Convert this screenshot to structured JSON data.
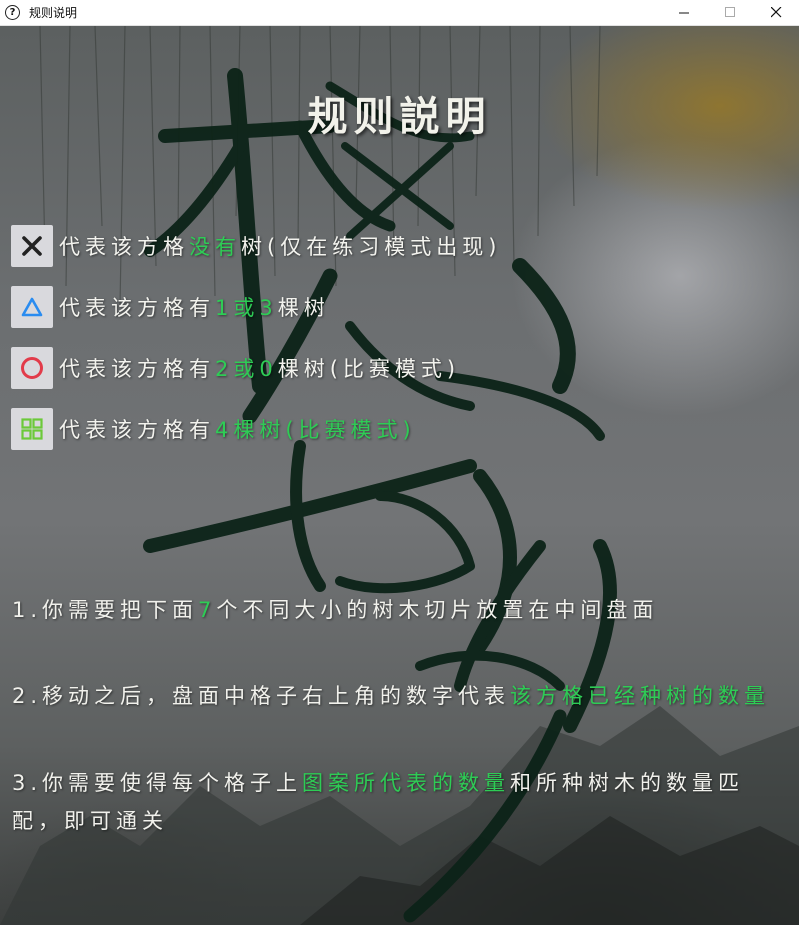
{
  "window": {
    "title": "规则说明",
    "icon": "question-icon",
    "controls": [
      "minimize-icon",
      "maximize-icon",
      "close-icon"
    ]
  },
  "header": {
    "title": "规则説明"
  },
  "watermark": {
    "text": "栖林智缘"
  },
  "legend": [
    {
      "icon": "cross-icon",
      "icon_color": "#222222",
      "parts": [
        {
          "text": "代表该方格",
          "hl": false
        },
        {
          "text": "没有",
          "hl": true
        },
        {
          "text": "树(仅在练习模式出现)",
          "hl": false
        }
      ]
    },
    {
      "icon": "triangle-icon",
      "icon_color": "#2a8cf0",
      "parts": [
        {
          "text": "代表该方格有",
          "hl": false
        },
        {
          "text": "1或3",
          "hl": true
        },
        {
          "text": "棵树",
          "hl": false
        }
      ]
    },
    {
      "icon": "circle-icon",
      "icon_color": "#e23b4a",
      "parts": [
        {
          "text": "代表该方格有",
          "hl": false
        },
        {
          "text": "2或0",
          "hl": true
        },
        {
          "text": "棵树(比赛模式)",
          "hl": false
        }
      ]
    },
    {
      "icon": "grid-icon",
      "icon_color": "#6cc93a",
      "parts": [
        {
          "text": "代表该方格有",
          "hl": false
        },
        {
          "text": "4棵树(比赛模式)",
          "hl": true
        }
      ]
    }
  ],
  "rules": [
    {
      "parts": [
        {
          "text": "1.你需要把下面",
          "hl": false
        },
        {
          "text": "7",
          "hl": true
        },
        {
          "text": "个不同大小的树木切片放置在中间盘面",
          "hl": false
        }
      ]
    },
    {
      "parts": [
        {
          "text": "2.移动之后，盘面中格子右上角的数字代表",
          "hl": false
        },
        {
          "text": "该方格已经种树的数量",
          "hl": true
        }
      ]
    },
    {
      "parts": [
        {
          "text": "3.你需要使得每个格子上",
          "hl": false
        },
        {
          "text": "图案所代表的数量",
          "hl": true
        },
        {
          "text": "和所种树木的数量匹配，即可通关",
          "hl": false
        }
      ]
    }
  ],
  "colors": {
    "highlight": "#2ecc55",
    "text": "#f2f2ed",
    "calligraphy": "#0c2318",
    "icon_bg": "#d9d9dd"
  }
}
